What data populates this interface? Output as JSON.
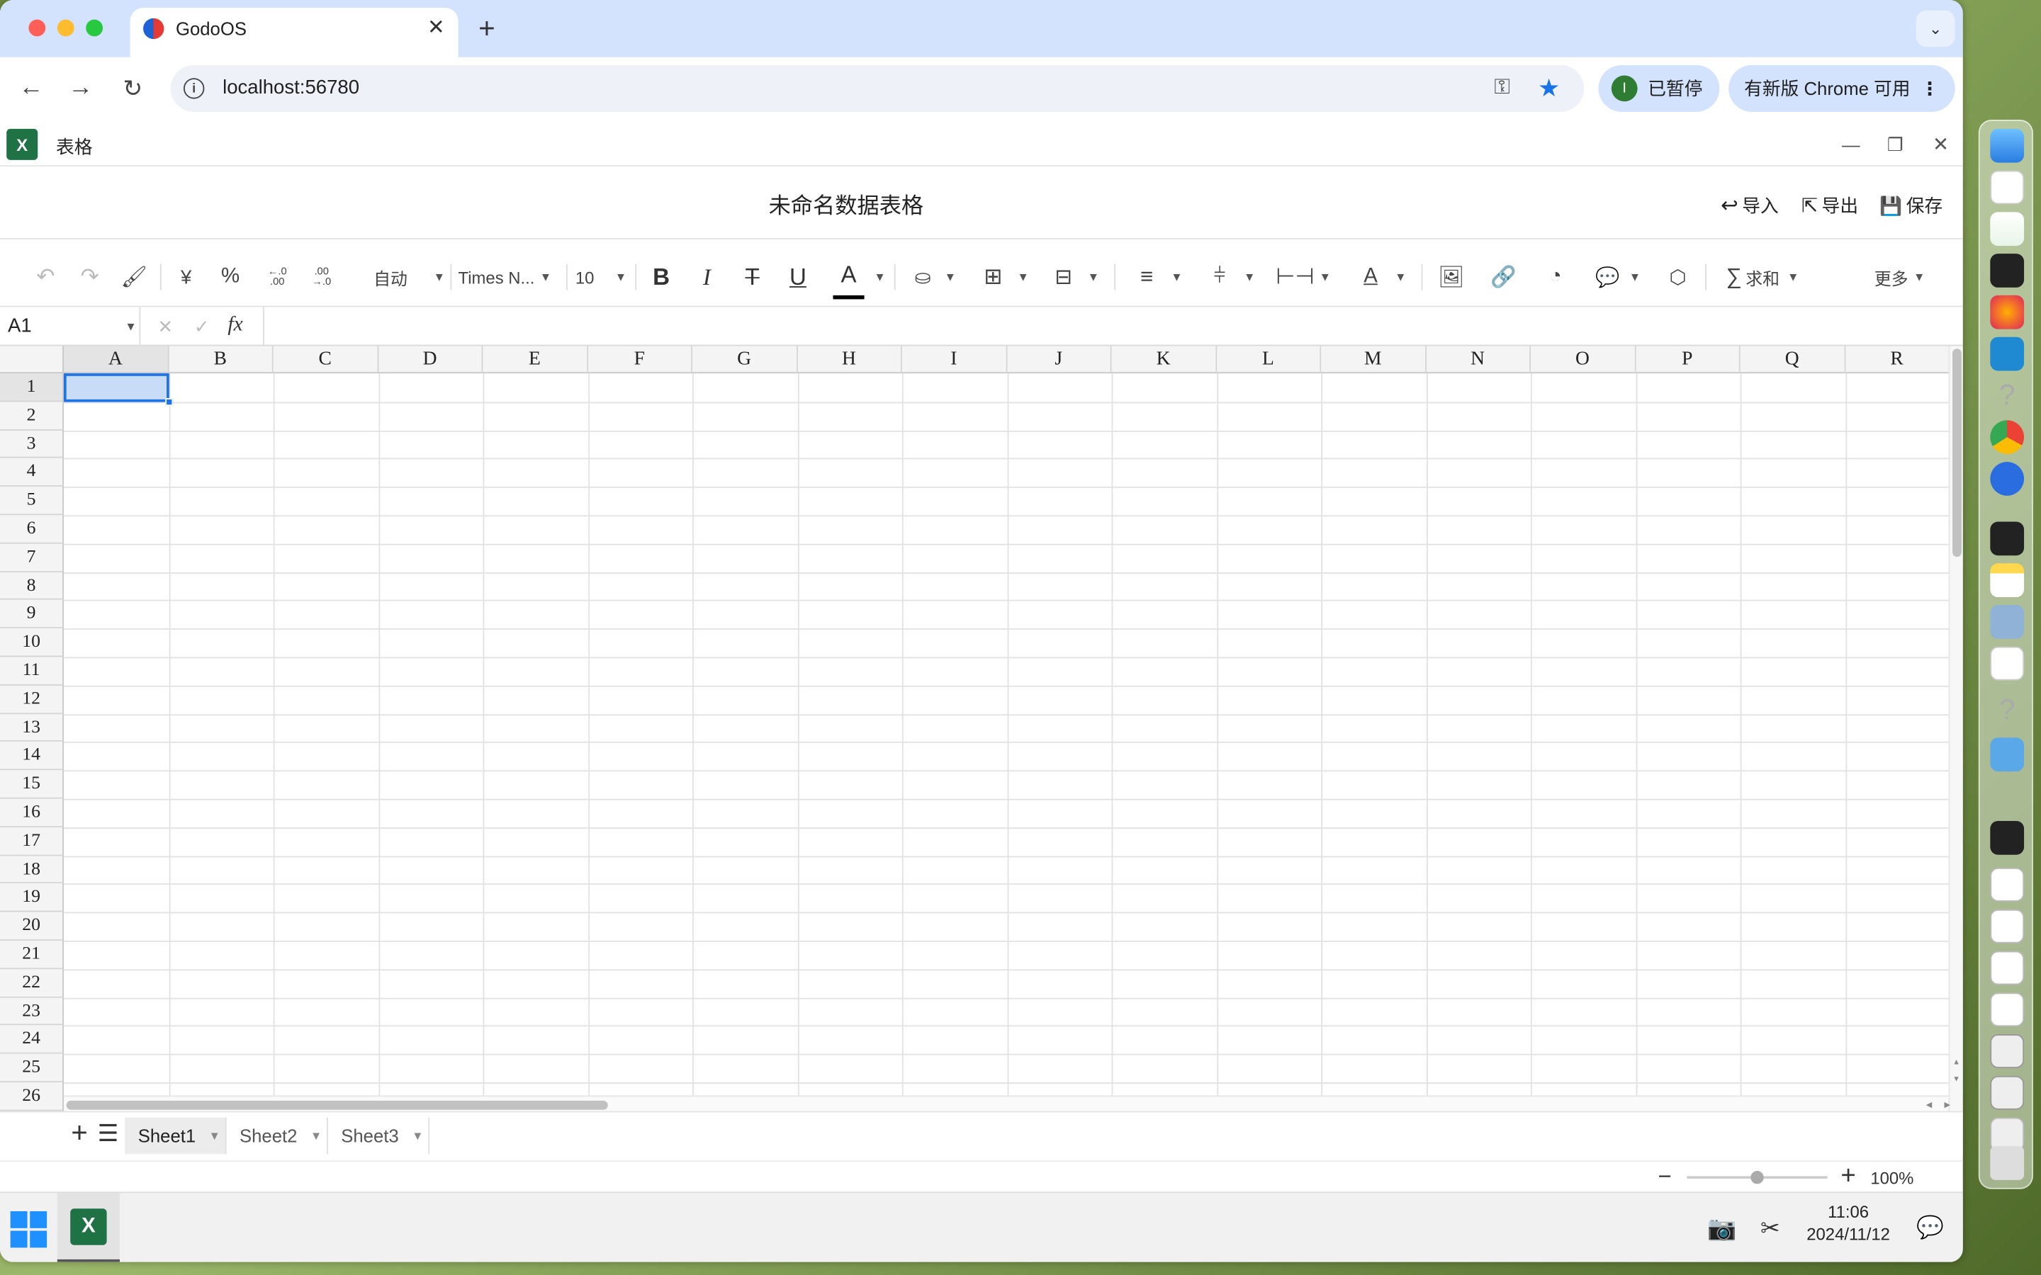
{
  "browser": {
    "tab_title": "GodoOS",
    "url": "localhost:56780",
    "profile_initial": "I",
    "profile_status": "已暂停",
    "update_label": "有新版 Chrome 可用"
  },
  "window": {
    "title": "表格"
  },
  "document": {
    "title": "未命名数据表格",
    "import_label": "导入",
    "export_label": "导出",
    "save_label": "保存"
  },
  "ribbon": {
    "currency": "¥",
    "percent": "%",
    "dec_inc": "←.0 .00",
    "dec_dec": ".00 →.0",
    "format": "自动",
    "font": "Times N...",
    "size": "10",
    "sum": "求和",
    "more": "更多"
  },
  "formula_bar": {
    "cell_ref": "A1",
    "fx": "fx",
    "value": ""
  },
  "grid": {
    "columns": [
      "A",
      "B",
      "C",
      "D",
      "E",
      "F",
      "G",
      "H",
      "I",
      "J",
      "K",
      "L",
      "M",
      "N",
      "O",
      "P",
      "Q",
      "R"
    ],
    "rows": [
      "1",
      "2",
      "3",
      "4",
      "5",
      "6",
      "7",
      "8",
      "9",
      "10",
      "11",
      "12",
      "13",
      "14",
      "15",
      "16",
      "17",
      "18",
      "19",
      "20",
      "21",
      "22",
      "23",
      "24",
      "25",
      "26"
    ],
    "selected_cell": "A1"
  },
  "sheets": {
    "tabs": [
      "Sheet1",
      "Sheet2",
      "Sheet3"
    ],
    "active": "Sheet1"
  },
  "status": {
    "zoom": "100%",
    "zoom_level": 0.5
  },
  "taskbar": {
    "time": "11:06",
    "date": "2024/11/12"
  },
  "colors": {
    "accent": "#1a73e8",
    "selection": "#c9dcf7",
    "excel_green": "#1f7244",
    "tab_bar": "#d3e3fd"
  }
}
